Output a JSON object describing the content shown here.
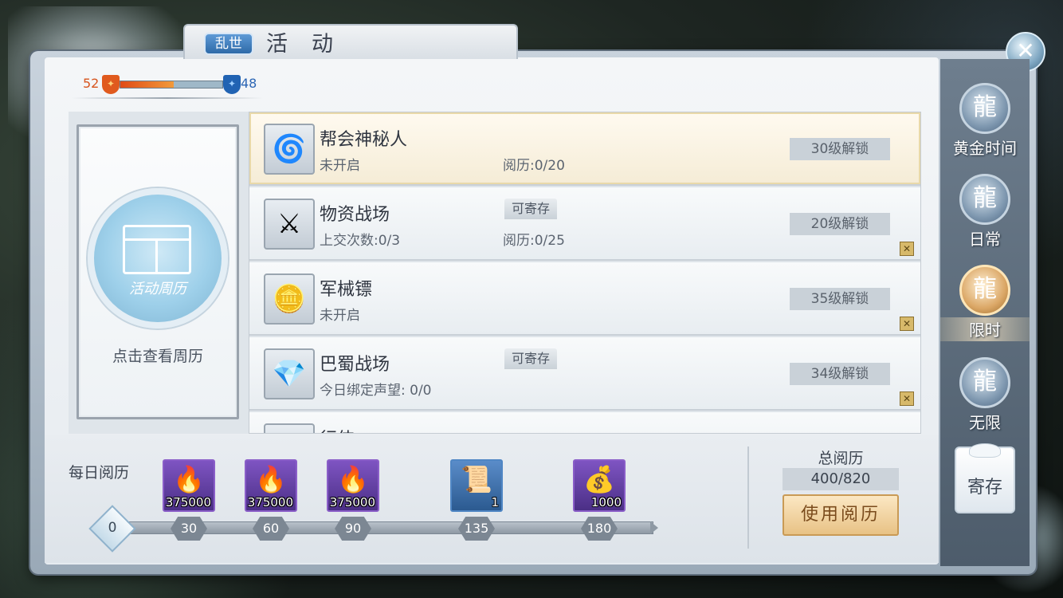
{
  "header": {
    "tag": "乱世",
    "title": "活动"
  },
  "close": {
    "icon": "close-icon",
    "glyph": "✕"
  },
  "faction": {
    "left_value": "52",
    "right_value": "48",
    "left_color": "#e05a1e",
    "right_color": "#2163b3",
    "left_share": 0.52
  },
  "calendar": {
    "orb_label": "活动周历",
    "hint": "点击查看周历"
  },
  "activities": [
    {
      "name": "帮会神秘人",
      "status": "未开启",
      "tag": "",
      "exp": "阅历:0/20",
      "lock": "30级解锁",
      "icon": "purple-swirl-icon",
      "glyph": "🌀",
      "selected": true
    },
    {
      "name": "物资战场",
      "status": "上交次数:0/3",
      "tag": "可寄存",
      "exp": "阅历:0/25",
      "lock": "20级解锁",
      "icon": "crossed-swords-icon",
      "glyph": "⚔",
      "selected": false
    },
    {
      "name": "军械镖",
      "status": "未开启",
      "tag": "",
      "exp": "",
      "lock": "35级解锁",
      "icon": "coins-icon",
      "glyph": "🪙",
      "selected": false
    },
    {
      "name": "巴蜀战场",
      "status": "今日绑定声望: 0/0",
      "tag": "可寄存",
      "exp": "",
      "lock": "34级解锁",
      "icon": "purple-crystal-icon",
      "glyph": "💎",
      "selected": false
    },
    {
      "name": "行侠",
      "status": "",
      "tag": "",
      "exp": "",
      "lock": "",
      "icon": "gold-item-icon",
      "glyph": "🏵",
      "selected": false
    }
  ],
  "daily": {
    "label": "每日阅历",
    "rewards": [
      {
        "count": "375000",
        "icon": "blue-flame-icon",
        "glyph": "🔥",
        "style": "purple"
      },
      {
        "count": "375000",
        "icon": "blue-flame-icon",
        "glyph": "🔥",
        "style": "purple"
      },
      {
        "count": "375000",
        "icon": "blue-flame-icon",
        "glyph": "🔥",
        "style": "purple"
      },
      {
        "count": "1",
        "icon": "scroll-icon",
        "glyph": "📜",
        "style": "blue"
      },
      {
        "count": "1000",
        "icon": "gold-coins-icon",
        "glyph": "💰",
        "style": "purple"
      }
    ],
    "milestones": [
      "0",
      "30",
      "60",
      "90",
      "135",
      "180"
    ],
    "progress": 0
  },
  "total": {
    "label": "总阅历",
    "value": "400/820",
    "use_button": "使用阅历"
  },
  "tabs": [
    {
      "label": "黄金时间",
      "icon": "dragon-emblem-icon",
      "glyph": "龍",
      "active": false
    },
    {
      "label": "日常",
      "icon": "dragon-emblem-icon",
      "glyph": "龍",
      "active": false
    },
    {
      "label": "限时",
      "icon": "dragon-emblem-icon",
      "glyph": "龍",
      "active": true
    },
    {
      "label": "无限",
      "icon": "dragon-emblem-icon",
      "glyph": "龍",
      "active": false
    }
  ],
  "deposit_button": "寄存"
}
